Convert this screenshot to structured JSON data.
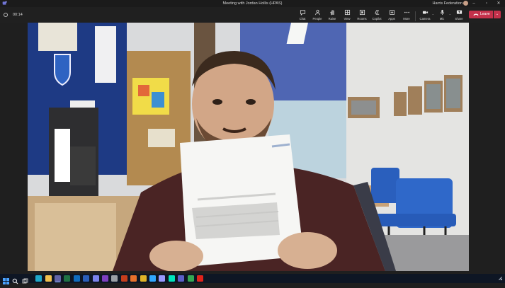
{
  "window": {
    "title": "Meeting with Jordan Hollis (HPAS)",
    "org": "Harris Federation",
    "icons": {
      "app": "teams-icon",
      "minimize": "minimize-icon",
      "maximize": "maximize-icon",
      "close": "close-icon"
    }
  },
  "toolbar": {
    "timer": "00:14",
    "buttons": [
      {
        "id": "chat",
        "label": "Chat",
        "icon": "chat-icon"
      },
      {
        "id": "people",
        "label": "People",
        "icon": "people-icon"
      },
      {
        "id": "raise",
        "label": "Raise",
        "icon": "hand-icon"
      },
      {
        "id": "view",
        "label": "View",
        "icon": "grid-icon"
      },
      {
        "id": "rooms",
        "label": "Rooms",
        "icon": "rooms-icon"
      },
      {
        "id": "copilot",
        "label": "Copilot",
        "icon": "copilot-icon"
      },
      {
        "id": "apps",
        "label": "Apps",
        "icon": "apps-icon"
      },
      {
        "id": "more",
        "label": "More",
        "icon": "more-icon"
      },
      {
        "id": "camera",
        "label": "Camera",
        "icon": "camera-icon"
      },
      {
        "id": "mic",
        "label": "Mic",
        "icon": "mic-icon"
      },
      {
        "id": "share",
        "label": "Share",
        "icon": "share-icon"
      }
    ],
    "leave_label": "Leave",
    "leave_color": "#c4314b"
  },
  "taskbar": {
    "apps": [
      {
        "id": "start",
        "icon": "windows-start-icon",
        "color": "#4aa3ff"
      },
      {
        "id": "search",
        "icon": "search-icon",
        "color": "#ffffff"
      },
      {
        "id": "taskview",
        "icon": "task-view-icon",
        "color": "#d0d0d0"
      },
      {
        "id": "edge",
        "icon": "edge-icon",
        "color": "#1fa8c9"
      },
      {
        "id": "explorer",
        "icon": "folder-icon",
        "color": "#f2c14e"
      },
      {
        "id": "teams",
        "icon": "teams-icon",
        "color": "#6264a7"
      },
      {
        "id": "excel",
        "icon": "excel-icon",
        "color": "#1f7244"
      },
      {
        "id": "outlook",
        "icon": "outlook-icon",
        "color": "#0f6cbd"
      },
      {
        "id": "word",
        "icon": "word-icon",
        "color": "#2b5eb8"
      },
      {
        "id": "teams2",
        "icon": "teams-icon",
        "color": "#7b83eb"
      },
      {
        "id": "onenote",
        "icon": "onenote-icon",
        "color": "#7d3fbf"
      },
      {
        "id": "app-gray",
        "icon": "app-icon",
        "color": "#9aa0a6"
      },
      {
        "id": "powerpoint",
        "icon": "powerpoint-icon",
        "color": "#c43e1c"
      },
      {
        "id": "app-orange",
        "icon": "app-icon",
        "color": "#e8712b"
      },
      {
        "id": "chrome",
        "icon": "chrome-icon",
        "color": "#e0b427"
      },
      {
        "id": "photoshop",
        "icon": "photoshop-icon",
        "color": "#31a8ff"
      },
      {
        "id": "premiere",
        "icon": "premiere-icon",
        "color": "#9999ff"
      },
      {
        "id": "audition",
        "icon": "audition-icon",
        "color": "#00e4bb"
      },
      {
        "id": "teams3",
        "icon": "teams-icon",
        "color": "#5b5fc7"
      },
      {
        "id": "chrome2",
        "icon": "chrome-icon",
        "color": "#34a853"
      },
      {
        "id": "acrobat",
        "icon": "acrobat-icon",
        "color": "#e2231a"
      }
    ],
    "tray_icon": "notification-icon"
  }
}
